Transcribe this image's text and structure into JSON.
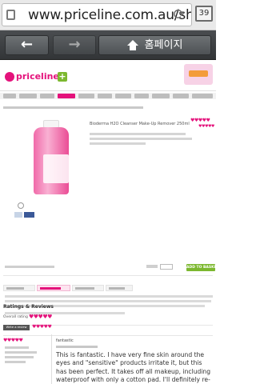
{
  "browser": {
    "url": "www.priceline.com.au/sh",
    "tab_count": "39",
    "home_label": "홈페이지"
  },
  "site": {
    "brand": "priceline",
    "brand_plus": "+",
    "product_title": "Bioderma H2O Cleanser Make-Up Remover 250ml",
    "add_button": "ADD TO BASKET"
  },
  "reviews": {
    "heading": "Ratings & Reviews",
    "average_label": "Overall rating",
    "write_button": "Write a review",
    "first_review_title": "fantastic",
    "first_review_text": "This is fantastic.  I have very fine skin around the eyes and \"sensitive\" products irritate it, but this has been perfect. It takes off all makeup, including waterproof with only a cotton pad.  I'll definitely re-buy this one."
  },
  "stars": "♥♥♥♥♥",
  "colors": {
    "brand_pink": "#e4127b",
    "add_green": "#7cb82f",
    "chrome_dark": "#3d4043"
  },
  "icons": [
    "lock-icon",
    "reload-icon",
    "back-arrow-icon",
    "forward-arrow-icon",
    "home-icon",
    "zoom-icon"
  ]
}
